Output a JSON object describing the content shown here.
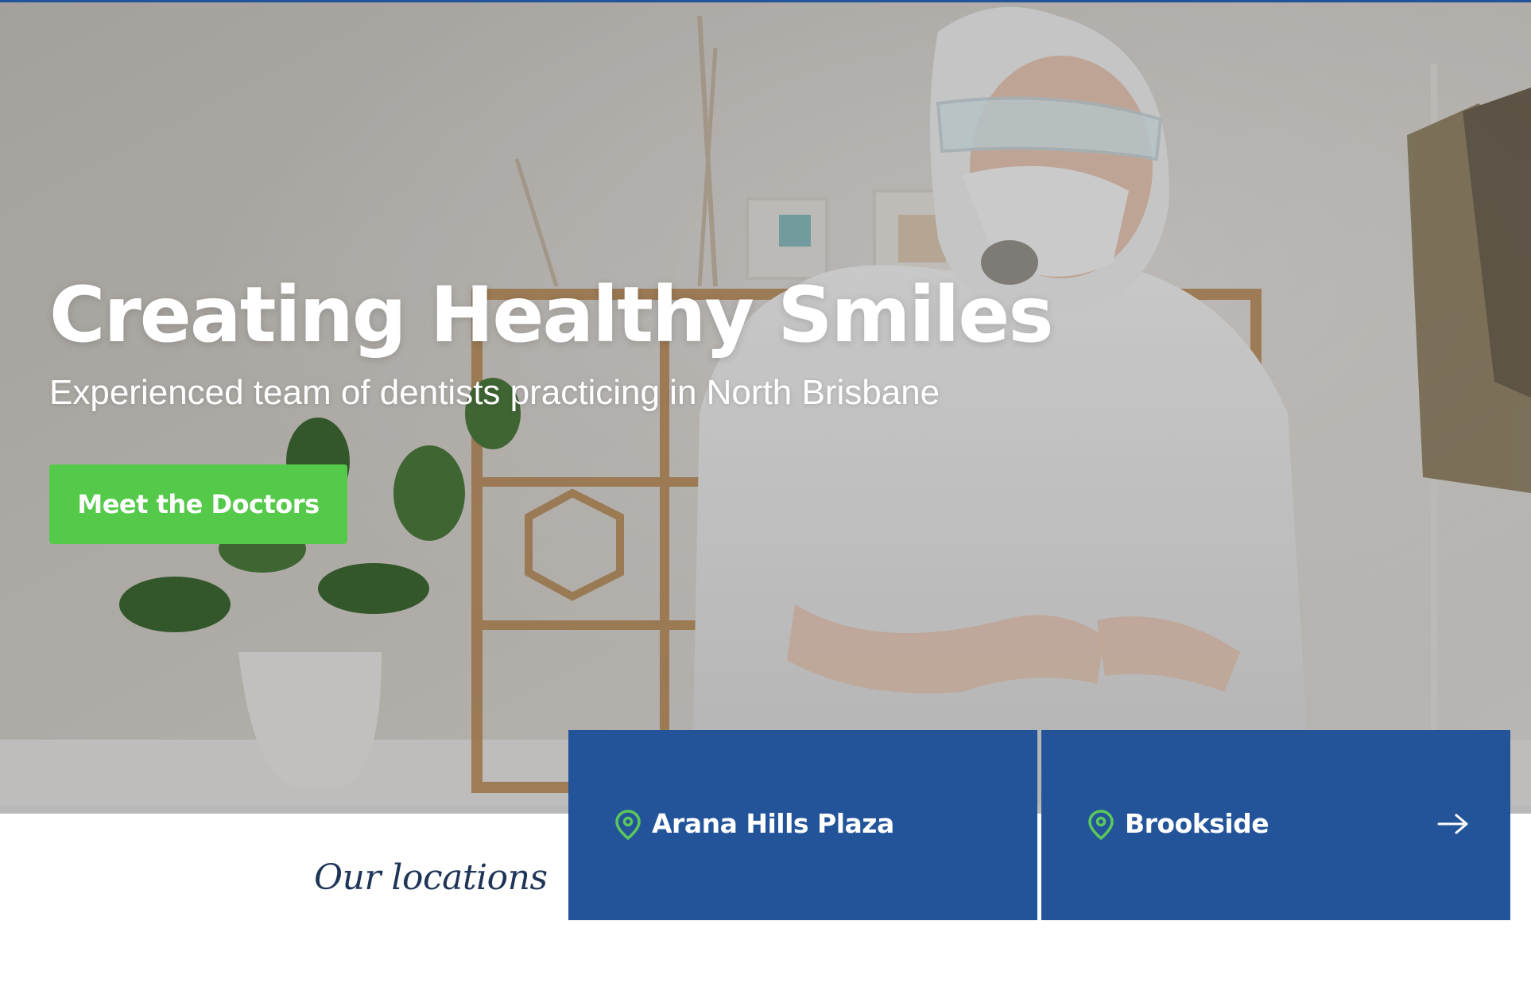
{
  "hero": {
    "title": "Creating Healthy Smiles",
    "subtitle": "Experienced team of dentists practicing in North Brisbane",
    "cta_label": "Meet the Doctors"
  },
  "locations": {
    "heading": "Our locations",
    "items": [
      {
        "name": "Arana Hills Plaza",
        "icon": "map-pin-icon"
      },
      {
        "name": "Brookside",
        "icon": "map-pin-icon",
        "arrow_icon": "arrow-right-icon"
      }
    ]
  },
  "colors": {
    "brand_blue": "#23549a",
    "cta_green": "#55c94a",
    "pin_green": "#5cc85a",
    "heading_navy": "#1f3557"
  }
}
